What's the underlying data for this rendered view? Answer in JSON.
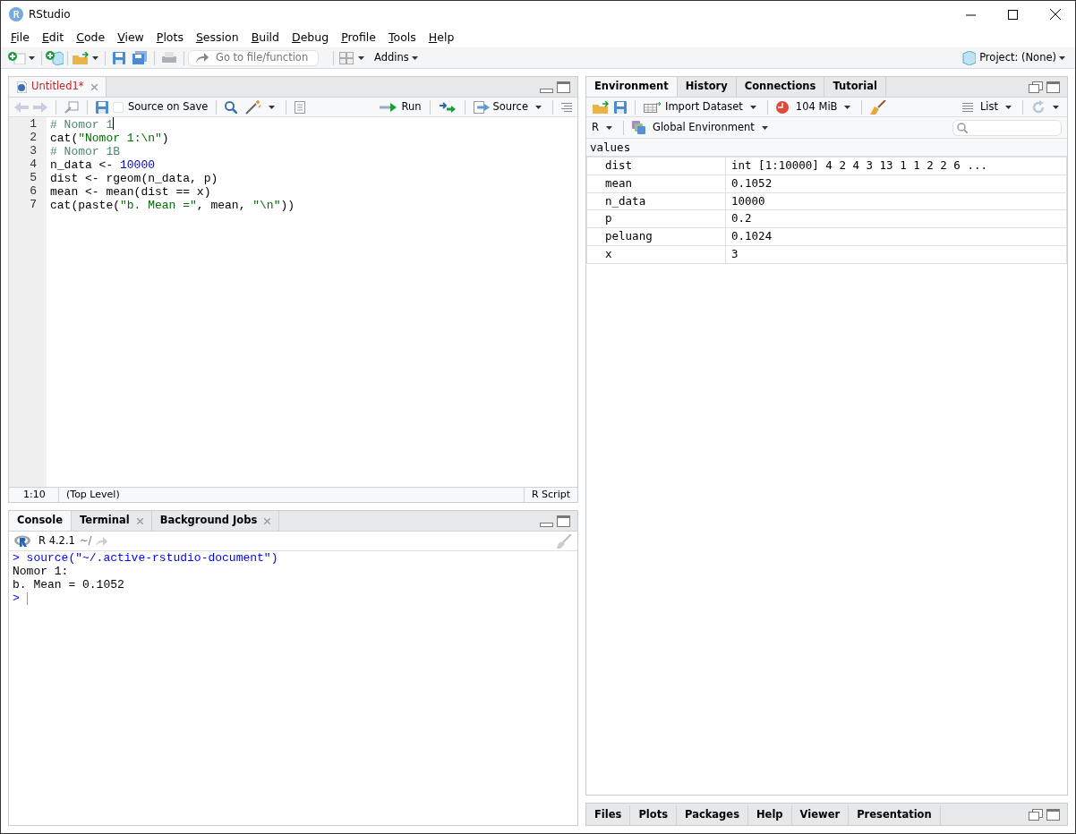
{
  "window": {
    "title": "RStudio"
  },
  "menu": [
    "File",
    "Edit",
    "Code",
    "View",
    "Plots",
    "Session",
    "Build",
    "Debug",
    "Profile",
    "Tools",
    "Help"
  ],
  "toolbar": {
    "goto_placeholder": "Go to file/function",
    "addins": "Addins",
    "project": "Project: (None)"
  },
  "editor": {
    "tabs": [
      {
        "label": "Untitled1*",
        "selected": true,
        "modified": true
      }
    ],
    "source_on_save": {
      "label": "Source on Save",
      "checked": false
    },
    "run": "Run",
    "source": "Source",
    "lines": [
      {
        "number": "1",
        "tokens": [
          {
            "kind": "comment",
            "text": "# Nomor 1"
          }
        ]
      },
      {
        "number": "2",
        "tokens": [
          {
            "kind": "plain",
            "text": "cat("
          },
          {
            "kind": "string",
            "text": "\"Nomor 1:\\n\""
          },
          {
            "kind": "plain",
            "text": ")"
          }
        ]
      },
      {
        "number": "3",
        "tokens": [
          {
            "kind": "comment",
            "text": "# Nomor 1B"
          }
        ]
      },
      {
        "number": "4",
        "tokens": [
          {
            "kind": "plain",
            "text": "n_data <- "
          },
          {
            "kind": "number",
            "text": "10000"
          }
        ]
      },
      {
        "number": "5",
        "tokens": [
          {
            "kind": "plain",
            "text": "dist <- rgeom(n_data, p)"
          }
        ]
      },
      {
        "number": "6",
        "tokens": [
          {
            "kind": "plain",
            "text": "mean <- mean(dist == x)"
          }
        ]
      },
      {
        "number": "7",
        "tokens": [
          {
            "kind": "plain",
            "text": "cat(paste("
          },
          {
            "kind": "string",
            "text": "\"b. Mean =\""
          },
          {
            "kind": "plain",
            "text": ", mean, "
          },
          {
            "kind": "string",
            "text": "\"\\n\""
          },
          {
            "kind": "plain",
            "text": "))"
          }
        ]
      }
    ],
    "status": {
      "position": "1:10",
      "scope": "(Top Level)",
      "file_type": "R Script"
    }
  },
  "console": {
    "tabs": [
      {
        "label": "Console",
        "selected": true,
        "closable": false
      },
      {
        "label": "Terminal",
        "selected": false,
        "closable": true
      },
      {
        "label": "Background Jobs",
        "selected": false,
        "closable": true
      }
    ],
    "version": "R 4.2.1",
    "path": "~/",
    "lines": [
      {
        "kind": "input",
        "text": "> source(\"~/.active-rstudio-document\")"
      },
      {
        "kind": "output",
        "text": "Nomor 1:"
      },
      {
        "kind": "output",
        "text": "b. Mean = 0.1052"
      },
      {
        "kind": "prompt",
        "text": ">"
      }
    ]
  },
  "environment": {
    "tabs": [
      {
        "label": "Environment",
        "selected": true
      },
      {
        "label": "History",
        "selected": false
      },
      {
        "label": "Connections",
        "selected": false
      },
      {
        "label": "Tutorial",
        "selected": false
      }
    ],
    "import": "Import Dataset",
    "memory": "104 MiB",
    "view": "List",
    "language": "R",
    "scope": "Global Environment",
    "section": "values",
    "rows": [
      {
        "name": "dist",
        "value": "int [1:10000] 4 2 4 3 13 1 1 2 2 6 ..."
      },
      {
        "name": "mean",
        "value": "0.1052"
      },
      {
        "name": "n_data",
        "value": "10000"
      },
      {
        "name": "p",
        "value": "0.2"
      },
      {
        "name": "peluang",
        "value": "0.1024"
      },
      {
        "name": "x",
        "value": "3"
      }
    ]
  },
  "files_pane": {
    "tabs": [
      {
        "label": "Files",
        "selected": false
      },
      {
        "label": "Plots",
        "selected": false
      },
      {
        "label": "Packages",
        "selected": false
      },
      {
        "label": "Help",
        "selected": false
      },
      {
        "label": "Viewer",
        "selected": false
      },
      {
        "label": "Presentation",
        "selected": false
      }
    ]
  }
}
